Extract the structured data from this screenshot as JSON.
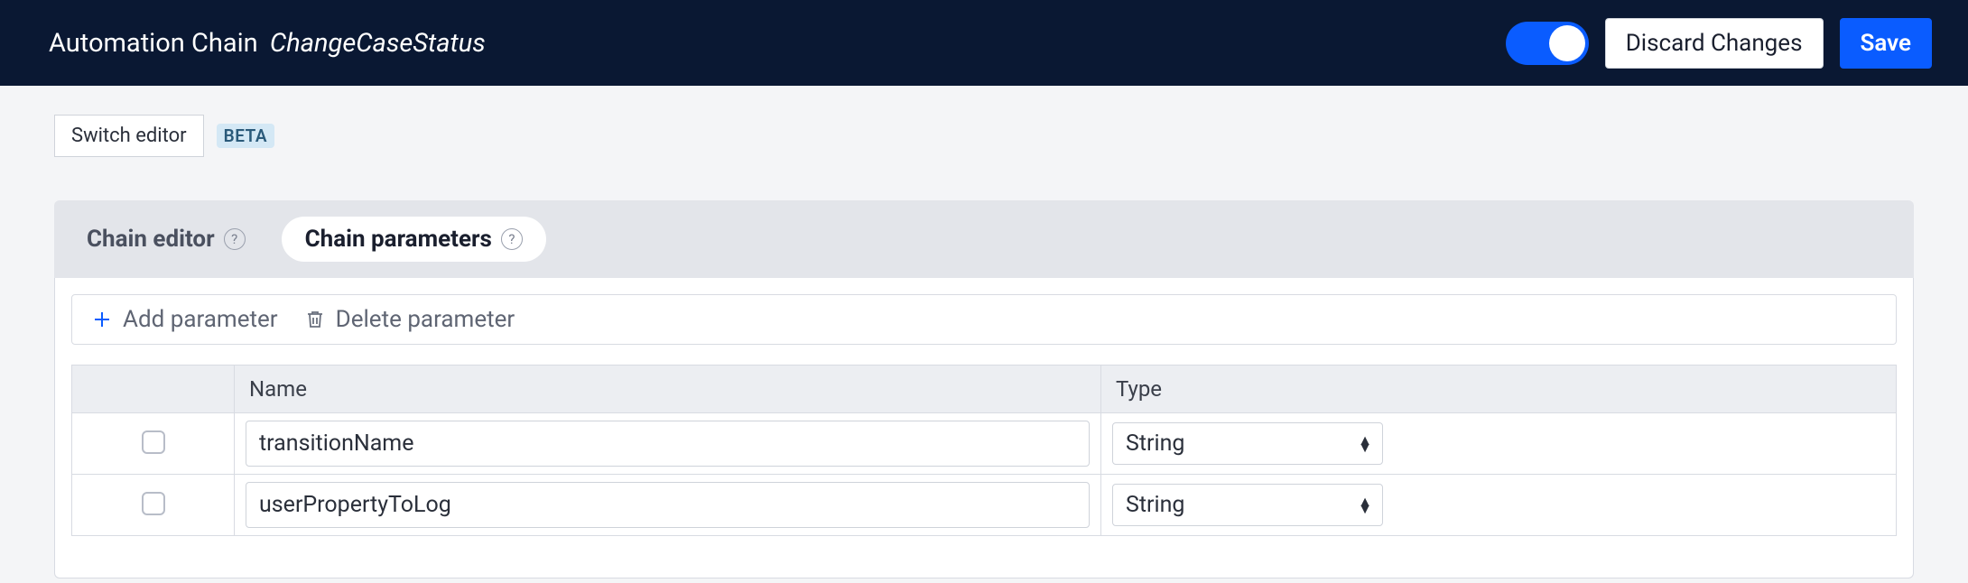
{
  "header": {
    "title_label": "Automation Chain",
    "title_name": "ChangeCaseStatus",
    "toggle_on": true,
    "discard_label": "Discard Changes",
    "save_label": "Save"
  },
  "switch_editor": {
    "button_label": "Switch editor",
    "beta_label": "BETA"
  },
  "tabs": {
    "chain_editor": "Chain editor",
    "chain_parameters": "Chain parameters",
    "help_glyph": "?"
  },
  "toolbar": {
    "add_label": "Add parameter",
    "delete_label": "Delete parameter"
  },
  "table": {
    "col_name": "Name",
    "col_type": "Type",
    "rows": [
      {
        "name": "transitionName",
        "type": "String"
      },
      {
        "name": "userPropertyToLog",
        "type": "String"
      }
    ]
  }
}
